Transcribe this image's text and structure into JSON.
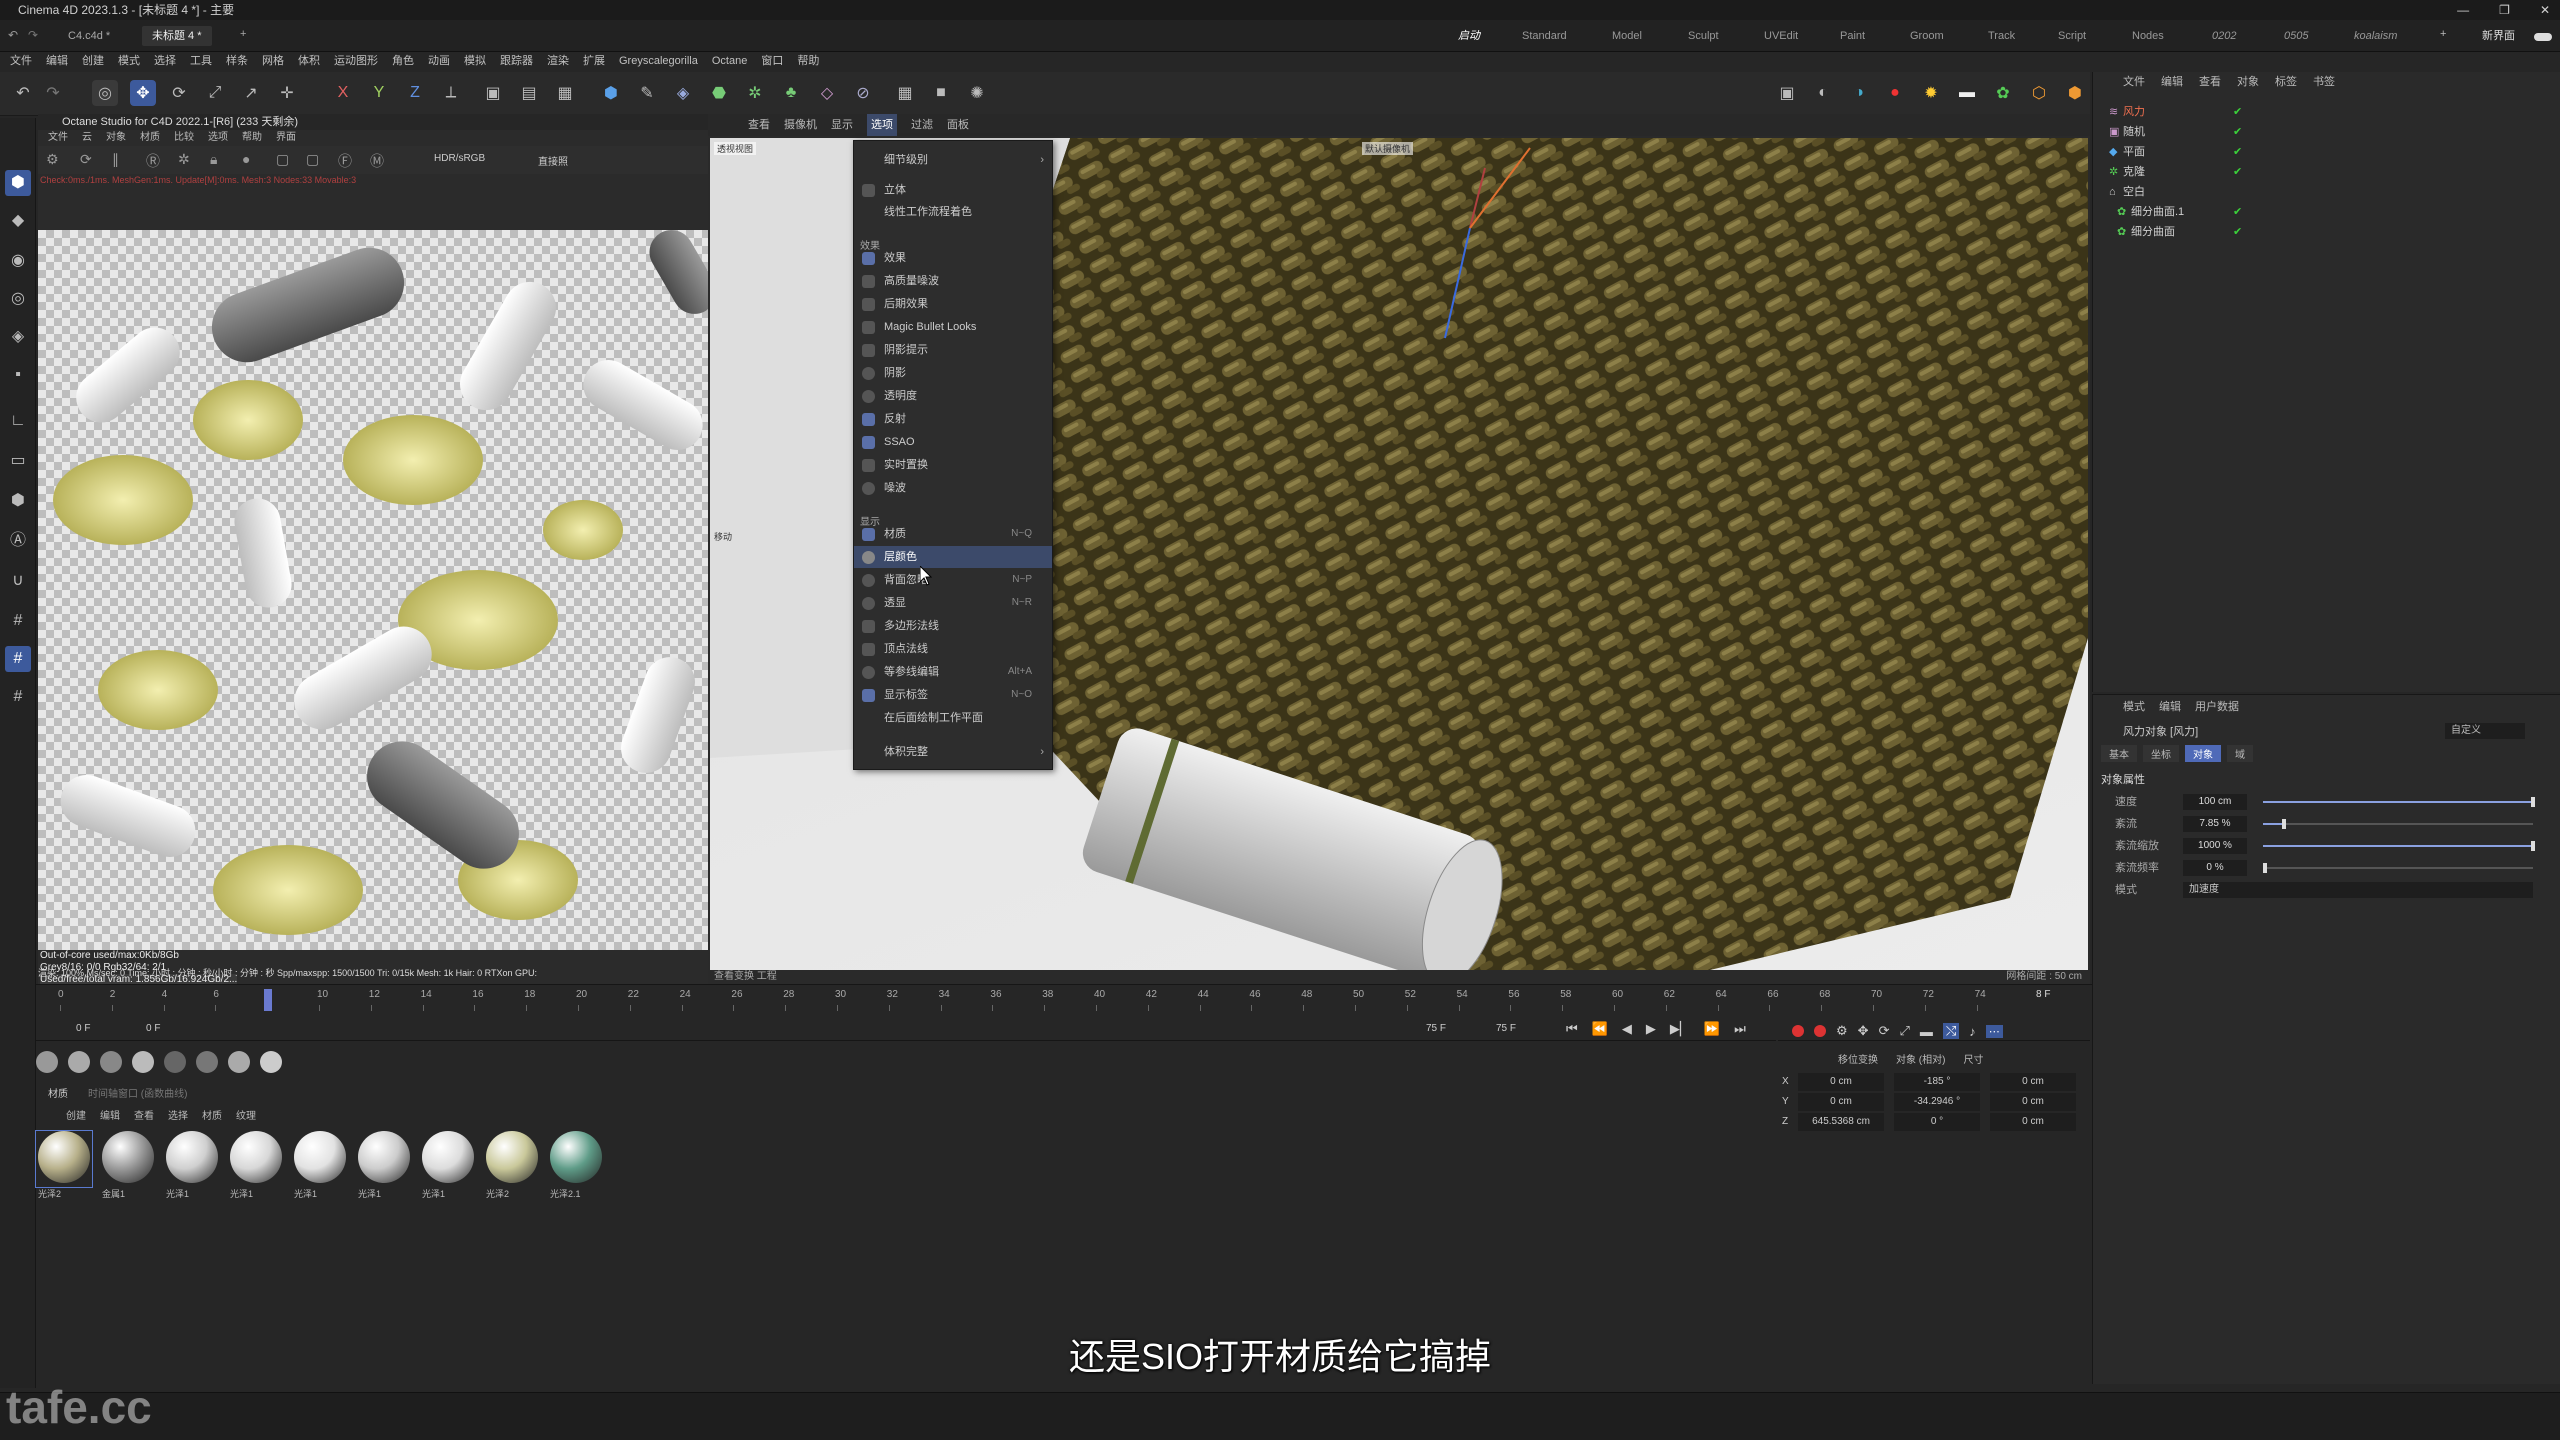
{
  "window": {
    "title": "Cinema 4D 2023.1.3 - [未标题 4 *] - 主要",
    "controls": [
      "—",
      "❐",
      "✕"
    ]
  },
  "doc_tabs": [
    "C4.c4d *",
    "未标题 4 *"
  ],
  "layouts": [
    "启动",
    "Standard",
    "Model",
    "Sculpt",
    "UVEdit",
    "Paint",
    "Groom",
    "Track",
    "Script",
    "Nodes",
    "0202",
    "0505",
    "koalaism"
  ],
  "layout_new": "新界面",
  "menubar": [
    "文件",
    "编辑",
    "创建",
    "模式",
    "选择",
    "工具",
    "样条",
    "网格",
    "体积",
    "运动图形",
    "角色",
    "动画",
    "模拟",
    "跟踪器",
    "渲染",
    "扩展",
    "Greyscalegorilla",
    "Octane",
    "窗口",
    "帮助"
  ],
  "octane": {
    "title": "Octane Studio for C4D 2022.1-[R6] (233 天剩余)",
    "menu": [
      "文件",
      "云",
      "对象",
      "材质",
      "比较",
      "选项",
      "帮助",
      "界面"
    ],
    "color_space": "HDR/sRGB",
    "mode": "直接照",
    "status_line": "Check:0ms./1ms. MeshGen:1ms. Update[M]:0ms. Mesh:3 Nodes:33 Movable:3",
    "info1": "Out-of-core used/max:0Kb/8Gb",
    "info2": "Grey8/16: 0/0        Rgb32/64: 2/1",
    "info3": "Used/free/total vram: 1.856Gb/16.924Gb/2...",
    "info4": "渲染: 100%  Ms/sec: 0  Time: 小时 : 分钟 : 秒/小时 : 分钟 : 秒  Spp/maxspp: 1500/1500  Tri: 0/15k  Mesh: 1k  Hair: 0  RTXon  GPU:"
  },
  "viewport": {
    "menu": [
      "查看",
      "摄像机",
      "显示",
      "选项",
      "过滤",
      "面板"
    ],
    "label_view": "透视视图",
    "label_camera": "默认摄像机",
    "label_move": "移动",
    "foot_left": "查看变换  工程",
    "foot_right": "网格间距 : 50 cm"
  },
  "dropdown": {
    "top_item": "细节级别",
    "items_a": [
      "立体",
      "线性工作流程着色"
    ],
    "section_effects": "效果",
    "effects": [
      "效果",
      "高质量噪波",
      "后期效果",
      "Magic Bullet Looks",
      "阴影提示",
      "阴影",
      "透明度",
      "反射",
      "SSAO",
      "实时置换",
      "噪波"
    ],
    "section_display": "显示",
    "display": [
      {
        "label": "材质",
        "shortcut": "N~Q"
      },
      {
        "label": "层颜色",
        "shortcut": ""
      },
      {
        "label": "背面忽略",
        "shortcut": "N~P"
      },
      {
        "label": "透显",
        "shortcut": "N~R"
      },
      {
        "label": "多边形法线",
        "shortcut": ""
      },
      {
        "label": "顶点法线",
        "shortcut": ""
      },
      {
        "label": "等参线编辑",
        "shortcut": "Alt+A"
      },
      {
        "label": "显示标签",
        "shortcut": "N~O"
      },
      {
        "label": "在后面绘制工作平面",
        "shortcut": ""
      }
    ],
    "bottom_item": "体积完整",
    "highlighted": "层颜色"
  },
  "objmgr": {
    "menu": [
      "文件",
      "编辑",
      "查看",
      "对象",
      "标签",
      "书签"
    ],
    "rows": [
      "风力",
      "随机",
      "平面",
      "克隆",
      "空白",
      "细分曲面.1",
      "细分曲面"
    ]
  },
  "attrmgr": {
    "menu": [
      "模式",
      "编辑",
      "用户数据"
    ],
    "object_name": "风力对象 [风力]",
    "preset": "自定义",
    "tabs": [
      "基本",
      "坐标",
      "对象",
      "域"
    ],
    "active_tab": "对象",
    "section": "对象属性",
    "props": [
      {
        "label": "速度",
        "value": "100 cm",
        "fraction": 1.0
      },
      {
        "label": "紊流",
        "value": "7.85 %",
        "fraction": 0.0785
      },
      {
        "label": "紊流缩放",
        "value": "1000 %",
        "fraction": 1.0
      },
      {
        "label": "紊流频率",
        "value": "0 %",
        "fraction": 0.0
      }
    ],
    "mode_label": "模式",
    "mode_value": "加速度"
  },
  "timeline": {
    "ticks": [
      "0",
      "2",
      "4",
      "6",
      "8",
      "10",
      "12",
      "14",
      "16",
      "18",
      "20",
      "22",
      "24",
      "26",
      "28",
      "30",
      "32",
      "34",
      "36",
      "38",
      "40",
      "42",
      "44",
      "46",
      "48",
      "50",
      "52",
      "54",
      "56",
      "58",
      "60",
      "62",
      "64",
      "66",
      "68",
      "70",
      "72",
      "74"
    ],
    "current_frame": "8 F",
    "start": "0 F",
    "start2": "0 F",
    "end": "75 F",
    "end2": "75 F"
  },
  "matmgr": {
    "tabs": [
      "材质",
      "时间轴窗口 (函数曲线)"
    ],
    "menu": [
      "创建",
      "编辑",
      "查看",
      "选择",
      "材质",
      "纹理"
    ],
    "materials": [
      {
        "name": "光泽2",
        "color": "#b7b08a"
      },
      {
        "name": "金属1",
        "color": "#9a9a9a"
      },
      {
        "name": "光泽1",
        "color": "#cfcfcf"
      },
      {
        "name": "光泽1",
        "color": "#d7d7d7"
      },
      {
        "name": "光泽1",
        "color": "#e2e2e2"
      },
      {
        "name": "光泽1",
        "color": "#cccccc"
      },
      {
        "name": "光泽1",
        "color": "#dcdcdc"
      },
      {
        "name": "光泽2",
        "color": "#c9c89a"
      },
      {
        "name": "光泽2.1",
        "color": "#5f9c88"
      }
    ]
  },
  "coords": {
    "menu": [
      "移位变换",
      "对象 (相对)",
      "尺寸"
    ],
    "rows": [
      {
        "axis": "X",
        "pos": "0 cm",
        "rot": "-185 °",
        "size": "0 cm"
      },
      {
        "axis": "Y",
        "pos": "0 cm",
        "rot": "-34.2946 °",
        "size": "0 cm"
      },
      {
        "axis": "Z",
        "pos": "645.5368 cm",
        "rot": "0 °",
        "size": "0 cm"
      }
    ]
  },
  "subtitle": "还是SIO打开材质给它搞掉",
  "watermark": "tafe.cc"
}
